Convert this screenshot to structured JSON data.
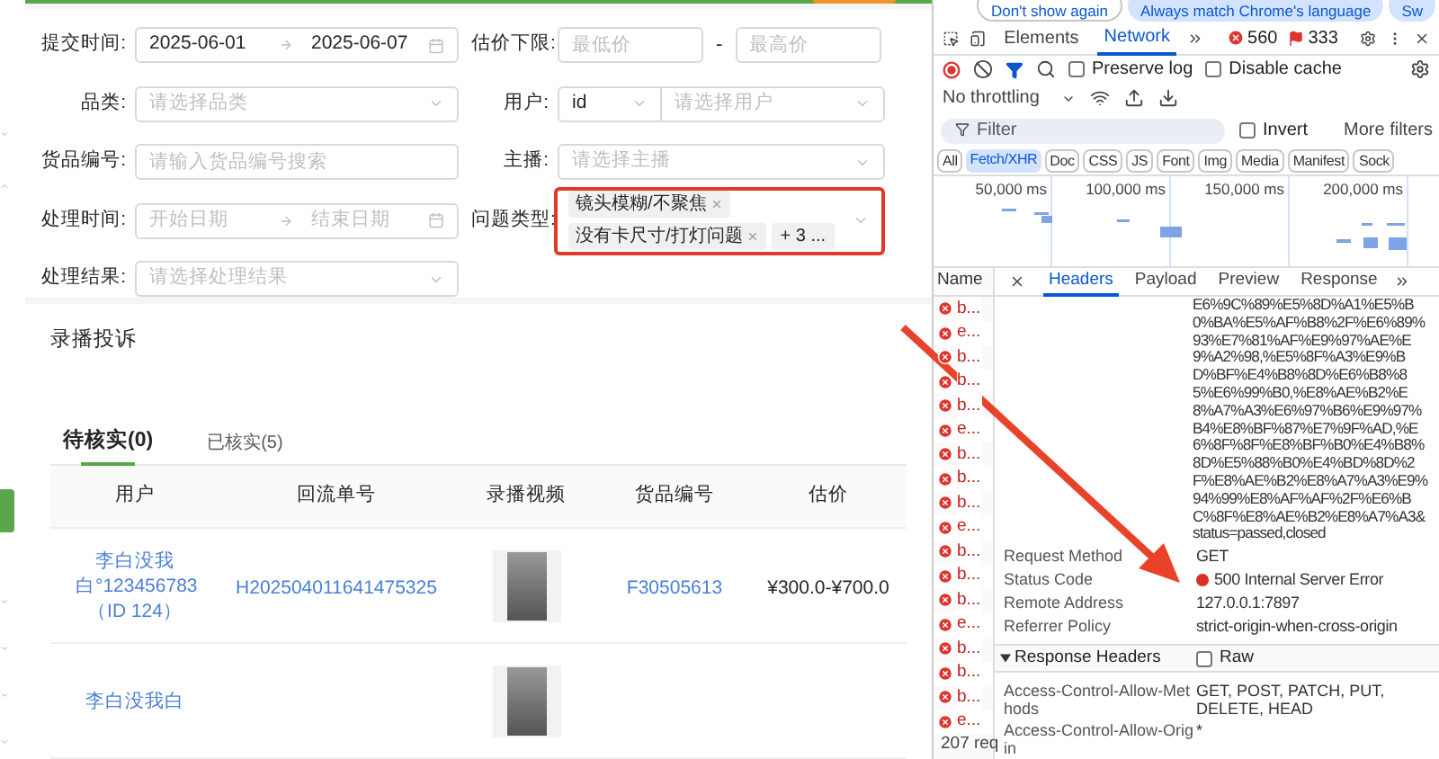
{
  "form": {
    "fields": [
      {
        "kind": "daterange",
        "label": "提交时间:",
        "start": {
          "value": "2025-06-01"
        },
        "end": {
          "value": "2025-06-07"
        }
      },
      {
        "kind": "range",
        "label": "估价下限:",
        "min": {
          "placeholder": "最低价"
        },
        "separator": "-",
        "max": {
          "placeholder": "最高价"
        }
      },
      {
        "kind": "select",
        "label": "品类:",
        "placeholder": "请选择品类"
      },
      {
        "kind": "user",
        "label": "用户:",
        "mode": "id",
        "placeholder": "请选择用户"
      },
      {
        "kind": "input",
        "label": "货品编号:",
        "placeholder": "请输入货品编号搜索"
      },
      {
        "kind": "select",
        "label": "主播:",
        "placeholder": "请选择主播"
      },
      {
        "kind": "daterange",
        "label": "处理时间:",
        "start": {
          "placeholder": "开始日期"
        },
        "end": {
          "placeholder": "结束日期"
        }
      },
      {
        "kind": "tags",
        "label": "问题类型:",
        "highlighted": true,
        "tags": [
          "镜头模糊/不聚焦",
          "没有卡尺寸/打灯问题"
        ],
        "more": "+ 3 ..."
      },
      {
        "kind": "select",
        "label": "处理结果:",
        "placeholder": "请选择处理结果"
      }
    ]
  },
  "card": {
    "title": "录播投诉",
    "tabs": [
      {
        "label": "待核实(0)",
        "selected": true
      },
      {
        "label": "已核实(5)",
        "selected": false
      }
    ],
    "table": {
      "columns": [
        "用户",
        "回流单号",
        "录播视频",
        "货品编号",
        "估价"
      ],
      "rows": [
        {
          "user": "李白没我白°123456783（ID 124）",
          "order": "H202504011641475325",
          "video": true,
          "goods": "F30505613",
          "price": "¥300.0-¥700.0"
        },
        {
          "user": "李白没我白",
          "video": true
        }
      ]
    }
  },
  "devtools": {
    "banner": [
      "Don't show again",
      "Always match Chrome's language",
      "Sw"
    ],
    "tabs": [
      {
        "label": "Elements",
        "selected": false
      },
      {
        "label": "Network",
        "selected": true
      }
    ],
    "errors": "560",
    "warnings": "333",
    "recording": true,
    "preserve_log": {
      "label": "Preserve log",
      "checked": false
    },
    "disable_cache": {
      "label": "Disable cache",
      "checked": false
    },
    "throttling": "No throttling",
    "filter": {
      "placeholder": "Filter"
    },
    "invert": {
      "label": "Invert",
      "checked": false
    },
    "more_filters": "More filters",
    "type_filters": [
      {
        "label": "All",
        "selected": false
      },
      {
        "label": "Fetch/XHR",
        "selected": true
      },
      {
        "label": "Doc",
        "selected": false
      },
      {
        "label": "CSS",
        "selected": false
      },
      {
        "label": "JS",
        "selected": false
      },
      {
        "label": "Font",
        "selected": false
      },
      {
        "label": "Img",
        "selected": false
      },
      {
        "label": "Media",
        "selected": false
      },
      {
        "label": "Manifest",
        "selected": false
      },
      {
        "label": "Sock",
        "selected": false
      }
    ],
    "overview_ticks": [
      "50,000 ms",
      "100,000 ms",
      "150,000 ms",
      "200,000 ms"
    ],
    "requests": {
      "column": "Name",
      "rows": [
        {
          "name": "b...",
          "failed": true
        },
        {
          "name": "e...",
          "failed": true
        },
        {
          "name": "b...",
          "failed": true
        },
        {
          "name": "b...",
          "failed": true
        },
        {
          "name": "b...",
          "failed": true
        },
        {
          "name": "e...",
          "failed": true
        },
        {
          "name": "b...",
          "failed": true
        },
        {
          "name": "b...",
          "failed": true
        },
        {
          "name": "b...",
          "failed": true
        },
        {
          "name": "e...",
          "failed": true
        },
        {
          "name": "b...",
          "failed": true
        },
        {
          "name": "b...",
          "failed": true
        },
        {
          "name": "b...",
          "failed": true
        },
        {
          "name": "e...",
          "failed": true
        },
        {
          "name": "b...",
          "failed": true
        },
        {
          "name": "b...",
          "failed": true
        },
        {
          "name": "b...",
          "failed": true
        },
        {
          "name": "e...",
          "failed": true
        }
      ],
      "summary": "207 req"
    },
    "detail_tabs": [
      {
        "label": "Headers",
        "selected": true
      },
      {
        "label": "Payload",
        "selected": false
      },
      {
        "label": "Preview",
        "selected": false
      },
      {
        "label": "Response",
        "selected": false
      }
    ],
    "url_lines": [
      "E6%9C%89%E5%8D%A1%E5%B",
      "0%BA%E5%AF%B8%2F%E6%89%",
      "93%E7%81%AF%E9%97%AE%E",
      "9%A2%98,%E5%8F%A3%E9%B",
      "D%BF%E4%B8%8D%E6%B8%8",
      "5%E6%99%B0,%E8%AE%B2%E",
      "8%A7%A3%E6%97%B6%E9%97%",
      "B4%E8%BF%87%E7%9F%AD,%E",
      "6%8F%8F%E8%BF%B0%E4%B8%",
      "8D%E5%88%B0%E4%BD%8D%2",
      "F%E8%AE%B2%E8%A7%A3%E9%",
      "94%99%E8%AF%AF%2F%E6%B",
      "C%8F%E8%AE%B2%E8%A7%A3&",
      "status=passed,closed"
    ],
    "general": [
      {
        "key": "Request Method",
        "value": "GET",
        "error": false
      },
      {
        "key": "Status Code",
        "value": "500 Internal Server Error",
        "error": true
      },
      {
        "key": "Remote Address",
        "value": "127.0.0.1:7897",
        "error": false
      },
      {
        "key": "Referrer Policy",
        "value": "strict-origin-when-cross-origin",
        "error": false
      }
    ],
    "response_headers": {
      "title": "Response Headers",
      "expanded": true,
      "raw": {
        "label": "Raw",
        "checked": false
      },
      "rows": [
        {
          "key": "Access-Control-Allow-Methods",
          "value": "GET, POST, PATCH, PUT, DELETE, HEAD"
        },
        {
          "key": "Access-Control-Allow-Origin",
          "value": "*"
        }
      ]
    }
  }
}
